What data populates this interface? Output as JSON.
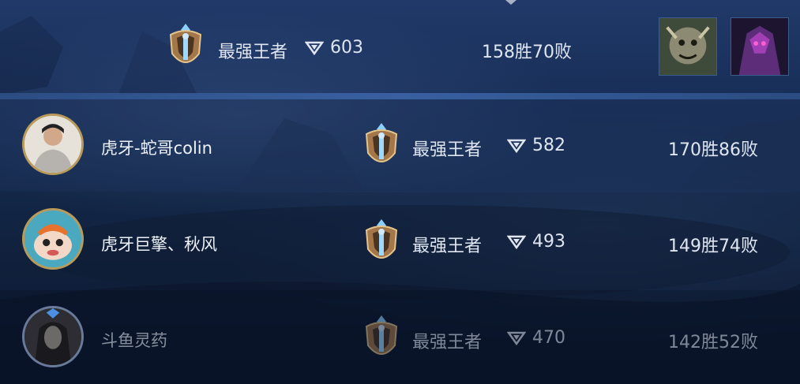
{
  "my_row": {
    "rank": "最强王者",
    "lp": "603",
    "record": "158胜70败",
    "champions": [
      {
        "icon": "champion-portrait-werewolf-icon"
      },
      {
        "icon": "champion-portrait-purple-assassin-icon"
      }
    ]
  },
  "players": [
    {
      "name": "虎牙-蛇哥colin",
      "rank": "最强王者",
      "lp": "582",
      "record": "170胜86败",
      "avatar": "player-avatar-man-icon"
    },
    {
      "name": "虎牙巨擎、秋风",
      "rank": "最强王者",
      "lp": "493",
      "record": "149胜74败",
      "avatar": "player-avatar-poro-icon"
    },
    {
      "name": "斗鱼灵药",
      "rank": "最强王者",
      "lp": "470",
      "record": "142胜52败",
      "avatar": "player-avatar-dark-champion-icon"
    }
  ],
  "colors": {
    "accent": "#3a64a8",
    "badge_gold": "#c9a56a",
    "text": "#dfe6f2"
  }
}
